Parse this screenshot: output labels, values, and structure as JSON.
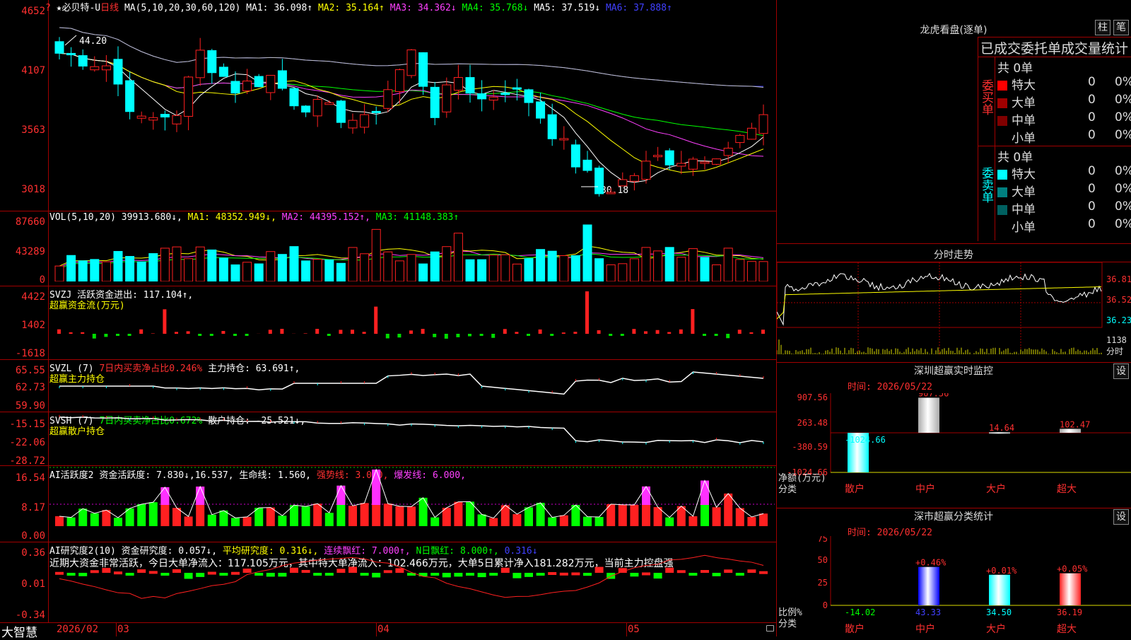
{
  "main": {
    "title": "★必贝特-U",
    "period": "日线",
    "ma_label": "MA(5,10,20,30,60,120)",
    "ma1": "MA1: 36.098↑",
    "ma2": "MA2: 35.164↑",
    "ma3": "MA3: 34.362↓",
    "ma4": "MA4: 35.768↓",
    "ma5": "MA5: 37.519↓",
    "ma6": "MA6: 37.888↑",
    "marker": "?",
    "y_ticks": [
      "4652",
      "4107",
      "3563",
      "3018"
    ],
    "high_label": "44.20",
    "low_label": "30.18"
  },
  "vol": {
    "label": "VOL(5,10,20)",
    "value": "39913.680↓,",
    "ma1": "MA1: 48352.949↓,",
    "ma2": "MA2: 44395.152↑,",
    "ma3": "MA3: 41148.383↑",
    "y_ticks": [
      "87660",
      "43289",
      "0"
    ]
  },
  "svzj": {
    "line1a": "SVZJ  活跃资金进出: 117.104↑,",
    "line2": "超赢资金流(万元)",
    "y_ticks": [
      "4422",
      "1402",
      "-1618"
    ]
  },
  "svzl": {
    "line1a": "SVZL (7)",
    "line1b": "7日内买卖净占比0.246%",
    "line1c": "主力持仓: 63.691↑,",
    "line2": "超赢主力持仓",
    "y_ticks": [
      "65.55",
      "62.73",
      "59.90"
    ]
  },
  "svsh": {
    "line1a": "SVSH (7)",
    "line1b": "7日内买卖净占比0.672%",
    "line1c": "散户持仓: -25.521↓,",
    "line2": "超赢散户持仓",
    "y_ticks": [
      "-15.15",
      "-22.06",
      "-28.72"
    ]
  },
  "ai1": {
    "a": "AI活跃度2",
    "b": "资金活跃度: 7.830↓,",
    "c": "16.537,",
    "d": "生命线: 1.560,",
    "e": "强势线: 3.000,",
    "f": "爆发线: 6.000,",
    "y_ticks": [
      "16.54",
      "8.17",
      "0.00"
    ]
  },
  "ai2": {
    "a": "AI研究度2(10)",
    "b": "资金研究度: 0.057↓,",
    "c": "平均研究度: 0.316↓,",
    "d": "连续飘红: 7.000↑,",
    "e": "N日飘红: 8.000↑,",
    "f": "0.316↓",
    "comment": "近期大资金非常活跃，今日大单净流入：117.105万元，其中特大单净流入：102.466万元，大单5日累计净入181.282万元，当前主力控盘强",
    "y_ticks": [
      "0.36",
      "0.01",
      "-0.34"
    ]
  },
  "bottom": {
    "brand": "大智慧",
    "dates": [
      "2026/02",
      "03",
      "04",
      "05"
    ]
  },
  "right": {
    "dragon_title": "龙虎看盘(逐单)",
    "btn_bar": "柱",
    "btn_pen": "笔",
    "table_title": "已成交委托单成交量统计",
    "buy_label": "委买单",
    "sell_label": "委卖单",
    "buy_total": "共 0单",
    "sell_total": "共 0单",
    "rows": [
      {
        "name": "特大",
        "val": "0",
        "pct": "0%"
      },
      {
        "name": "大单",
        "val": "0",
        "pct": "0%"
      },
      {
        "name": "中单",
        "val": "0",
        "pct": "0%"
      },
      {
        "name": "小单",
        "val": "0",
        "pct": "0%"
      }
    ],
    "buy_colors": [
      "#ff0000",
      "#a00000",
      "#800000",
      "#000000"
    ],
    "sell_colors": [
      "#00ffff",
      "#008080",
      "#006060",
      "#000000"
    ],
    "intraday_title": "分时走势",
    "intraday_ticks": [
      "36.81",
      "36.52",
      "36.23",
      "1138",
      "分时"
    ],
    "sz_title": "深圳超赢实时监控",
    "sz_set": "设",
    "sz_time": "时间: 2026/05/22",
    "sz_ticks": [
      "907.56",
      "263.48",
      "-380.59",
      "-1024.66"
    ],
    "sz_ylabel": "净额(万元)",
    "sz_ylabel2": "分类",
    "sz_categories": [
      "散户",
      "中户",
      "大户",
      "超大"
    ],
    "sz_values": [
      "-1024.66",
      "907.56",
      "14.64",
      "102.47"
    ],
    "sh_title": "深市超赢分类统计",
    "sh_set": "设",
    "sh_time": "时间: 2026/05/22",
    "sh_ticks": [
      "75",
      "50",
      "25",
      "0"
    ],
    "sh_ylabel": "比例%",
    "sh_ylabel2": "分类",
    "sh_categories": [
      "散户",
      "中户",
      "大户",
      "超大"
    ],
    "sh_values": [
      "-14.02",
      "43.33",
      "34.50",
      "36.19"
    ],
    "sh_changes": [
      "",
      "+0.46%",
      "+0.01%",
      "+0.05%"
    ]
  },
  "colors": {
    "up": "#ff2020",
    "down": "#00ffff",
    "ma1": "#ffffff",
    "ma2": "#ffff00",
    "ma3": "#ff40ff",
    "ma4": "#00ff00",
    "ma5": "#c0c0c0",
    "ma6": "#4040ff",
    "frame": "#a00000"
  }
}
